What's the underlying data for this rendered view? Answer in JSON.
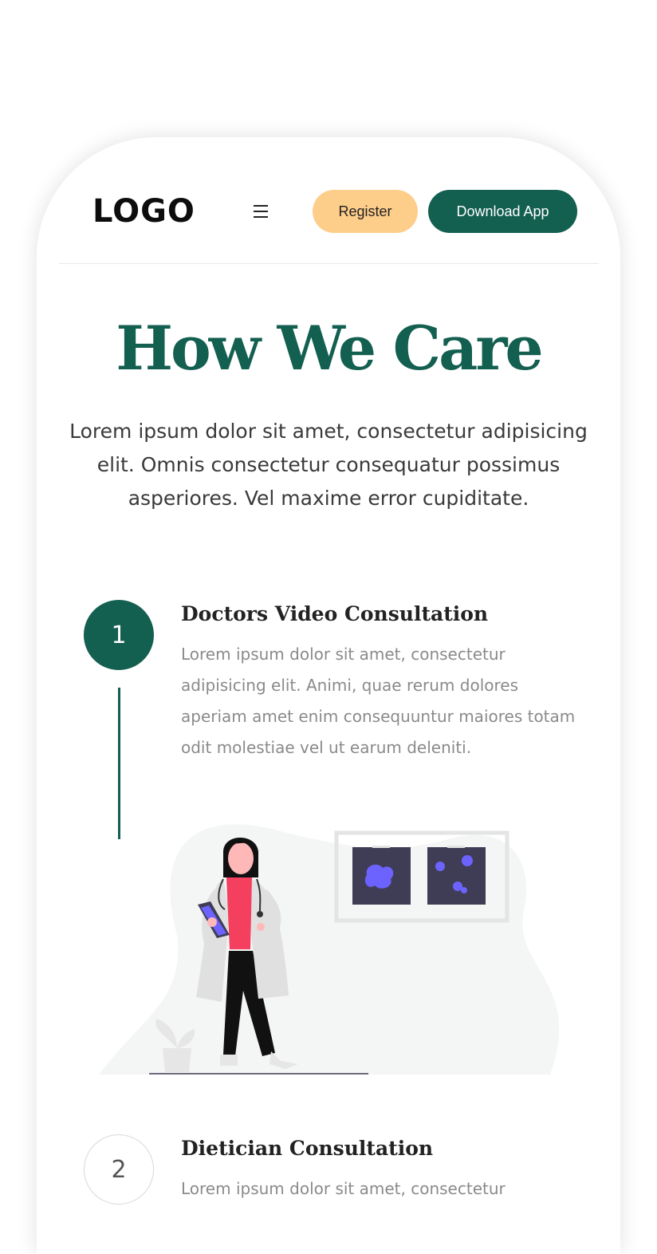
{
  "nav": {
    "logo": "LOGO",
    "menu_icon": "hamburger-menu-icon",
    "register_label": "Register",
    "download_label": "Download App"
  },
  "hero": {
    "title": "How We Care",
    "description": "Lorem ipsum dolor sit amet, consectetur adipisicing elit. Omnis consectetur consequatur possimus asperiores. Vel maxime error cupiditate."
  },
  "steps": [
    {
      "number": "1",
      "title": "Doctors Video Consultation",
      "description": "Lorem ipsum dolor sit amet, consectetur adipisicing elit. Animi, quae rerum dolores aperiam amet enim consequuntur maiores totam odit molestiae vel ut earum deleniti."
    },
    {
      "number": "2",
      "title": "Dietician Consultation",
      "description": "Lorem ipsum dolor sit amet, consectetur"
    }
  ],
  "colors": {
    "primary": "#135f50",
    "accent": "#fdcd8a",
    "illustration_accent": "#6c63ff",
    "illustration_pink": "#f43f5e"
  }
}
